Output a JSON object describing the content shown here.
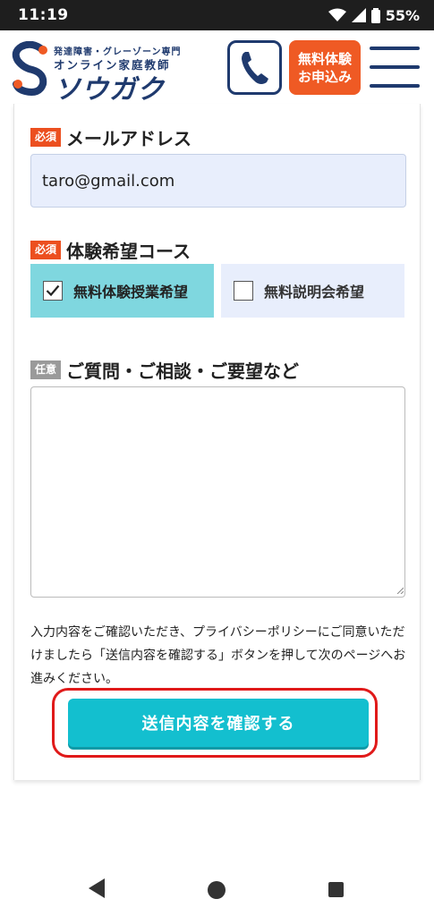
{
  "status_bar": {
    "time": "11:19",
    "battery": "55%"
  },
  "header": {
    "logo_sub_top": "発達障害・グレーゾーン専門",
    "logo_sub": "オンライン家庭教師",
    "logo_main": "ソウガク",
    "phone_icon": "phone-icon",
    "trial_line1": "無料体験",
    "trial_line2": "お申込み",
    "menu_icon": "hamburger-icon",
    "brand_color": "#1f3a6e",
    "accent_color": "#ef5a24"
  },
  "form": {
    "email": {
      "badge": "必須",
      "label": "メールアドレス",
      "value": "taro@gmail.com"
    },
    "course": {
      "badge": "必須",
      "label": "体験希望コース",
      "options": [
        {
          "label": "無料体験授業希望",
          "checked": true
        },
        {
          "label": "無料説明会希望",
          "checked": false
        }
      ]
    },
    "questions": {
      "badge": "任意",
      "label": "ご質問・ご相談・ご要望など",
      "value": ""
    },
    "notice": "入力内容をご確認いただき、プライバシーポリシーにご同意いただけましたら「送信内容を確認する」ボタンを押して次のページへお進みください。",
    "submit_label": "送信内容を確認する",
    "submit_color": "#13bfcf",
    "highlight_color": "#e01a1a"
  }
}
